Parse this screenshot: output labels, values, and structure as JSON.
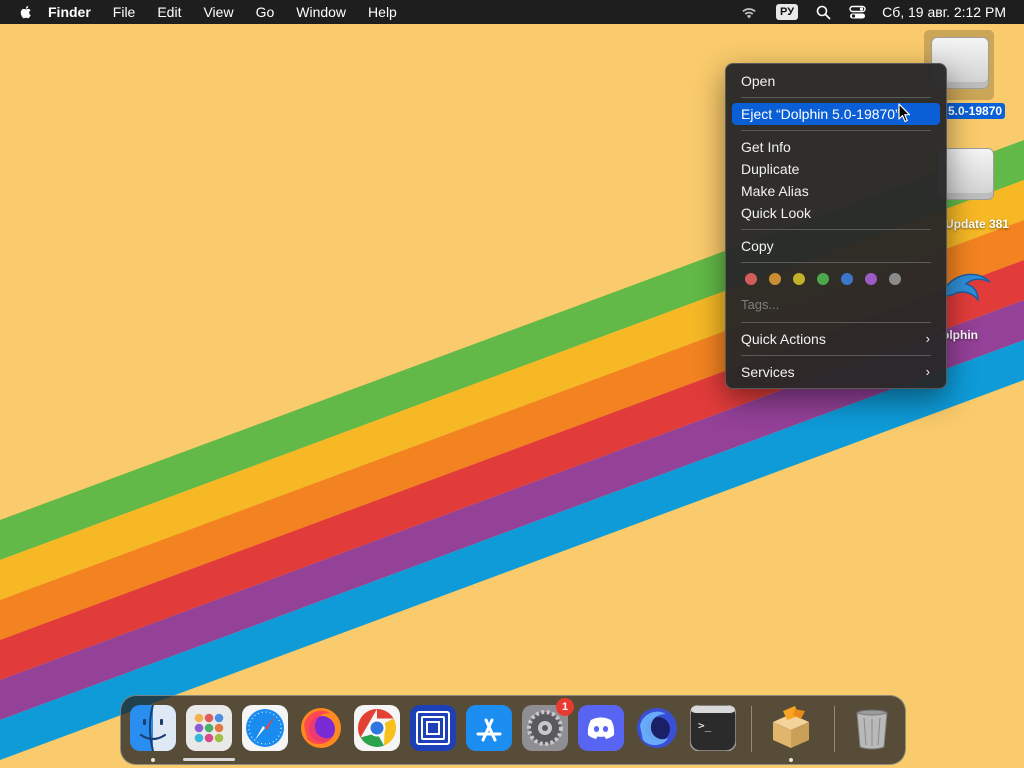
{
  "menubar": {
    "apple_icon": "apple-logo-icon",
    "app_name": "Finder",
    "items": [
      "File",
      "Edit",
      "View",
      "Go",
      "Window",
      "Help"
    ],
    "status": {
      "wifi_icon": "wifi-icon",
      "input_source": "РУ",
      "spotlight_icon": "search-icon",
      "control_center_icon": "control-center-icon",
      "clock": "Сб, 19 авг. 2:12 PM"
    }
  },
  "desktop": {
    "icons": [
      {
        "label": "5.0-19870",
        "icon": "disk-image-icon",
        "selected": true
      },
      {
        "label": "Update 381",
        "icon": "disk-image-icon",
        "selected": false
      },
      {
        "label": "olphin",
        "icon": "dolphin-app-icon",
        "selected": false
      }
    ]
  },
  "context_menu": {
    "open": "Open",
    "eject": "Eject “Dolphin 5.0-19870”",
    "get_info": "Get Info",
    "duplicate": "Duplicate",
    "make_alias": "Make Alias",
    "quick_look": "Quick Look",
    "copy": "Copy",
    "tag_colors": [
      {
        "name": "red",
        "color": "#d15c5a"
      },
      {
        "name": "orange",
        "color": "#c98d34"
      },
      {
        "name": "yellow",
        "color": "#c2b22b"
      },
      {
        "name": "green",
        "color": "#4ca84d"
      },
      {
        "name": "blue",
        "color": "#3c76cc"
      },
      {
        "name": "purple",
        "color": "#9b5bc4"
      },
      {
        "name": "gray",
        "color": "#8b8b8b"
      }
    ],
    "tags_placeholder": "Tags...",
    "quick_actions": "Quick Actions",
    "services": "Services",
    "submenu_arrow": "›"
  },
  "dock": {
    "apps": [
      {
        "name": "Finder",
        "icon": "finder-icon",
        "running": true
      },
      {
        "name": "Launchpad",
        "icon": "launchpad-icon",
        "running": false
      },
      {
        "name": "Safari",
        "icon": "safari-icon",
        "running": false
      },
      {
        "name": "Firefox",
        "icon": "firefox-icon",
        "running": false
      },
      {
        "name": "Chrome",
        "icon": "chrome-icon",
        "running": false
      },
      {
        "name": "Screen Sharing",
        "icon": "screen-sharing-icon",
        "running": false
      },
      {
        "name": "App Store",
        "icon": "app-store-icon",
        "running": false
      },
      {
        "name": "System Settings",
        "icon": "system-settings-icon",
        "running": false,
        "badge": "1"
      },
      {
        "name": "Discord",
        "icon": "discord-icon",
        "running": false
      },
      {
        "name": "Firefox Nightly",
        "icon": "firefox-nightly-icon",
        "running": false
      },
      {
        "name": "Terminal",
        "icon": "terminal-icon",
        "running": false
      },
      {
        "name": "Installer",
        "icon": "installer-icon",
        "running": true
      },
      {
        "name": "Trash",
        "icon": "trash-icon",
        "running": false
      }
    ],
    "terminal_prompt": ">_"
  },
  "colors": {
    "wallpaper_bg": "#f9cb6c",
    "stripes": [
      "#62b947",
      "#f6b825",
      "#f38321",
      "#e23c3a",
      "#944198",
      "#0e9bd8"
    ],
    "highlight": "#0a5fd6",
    "badge": "#e83b30"
  }
}
